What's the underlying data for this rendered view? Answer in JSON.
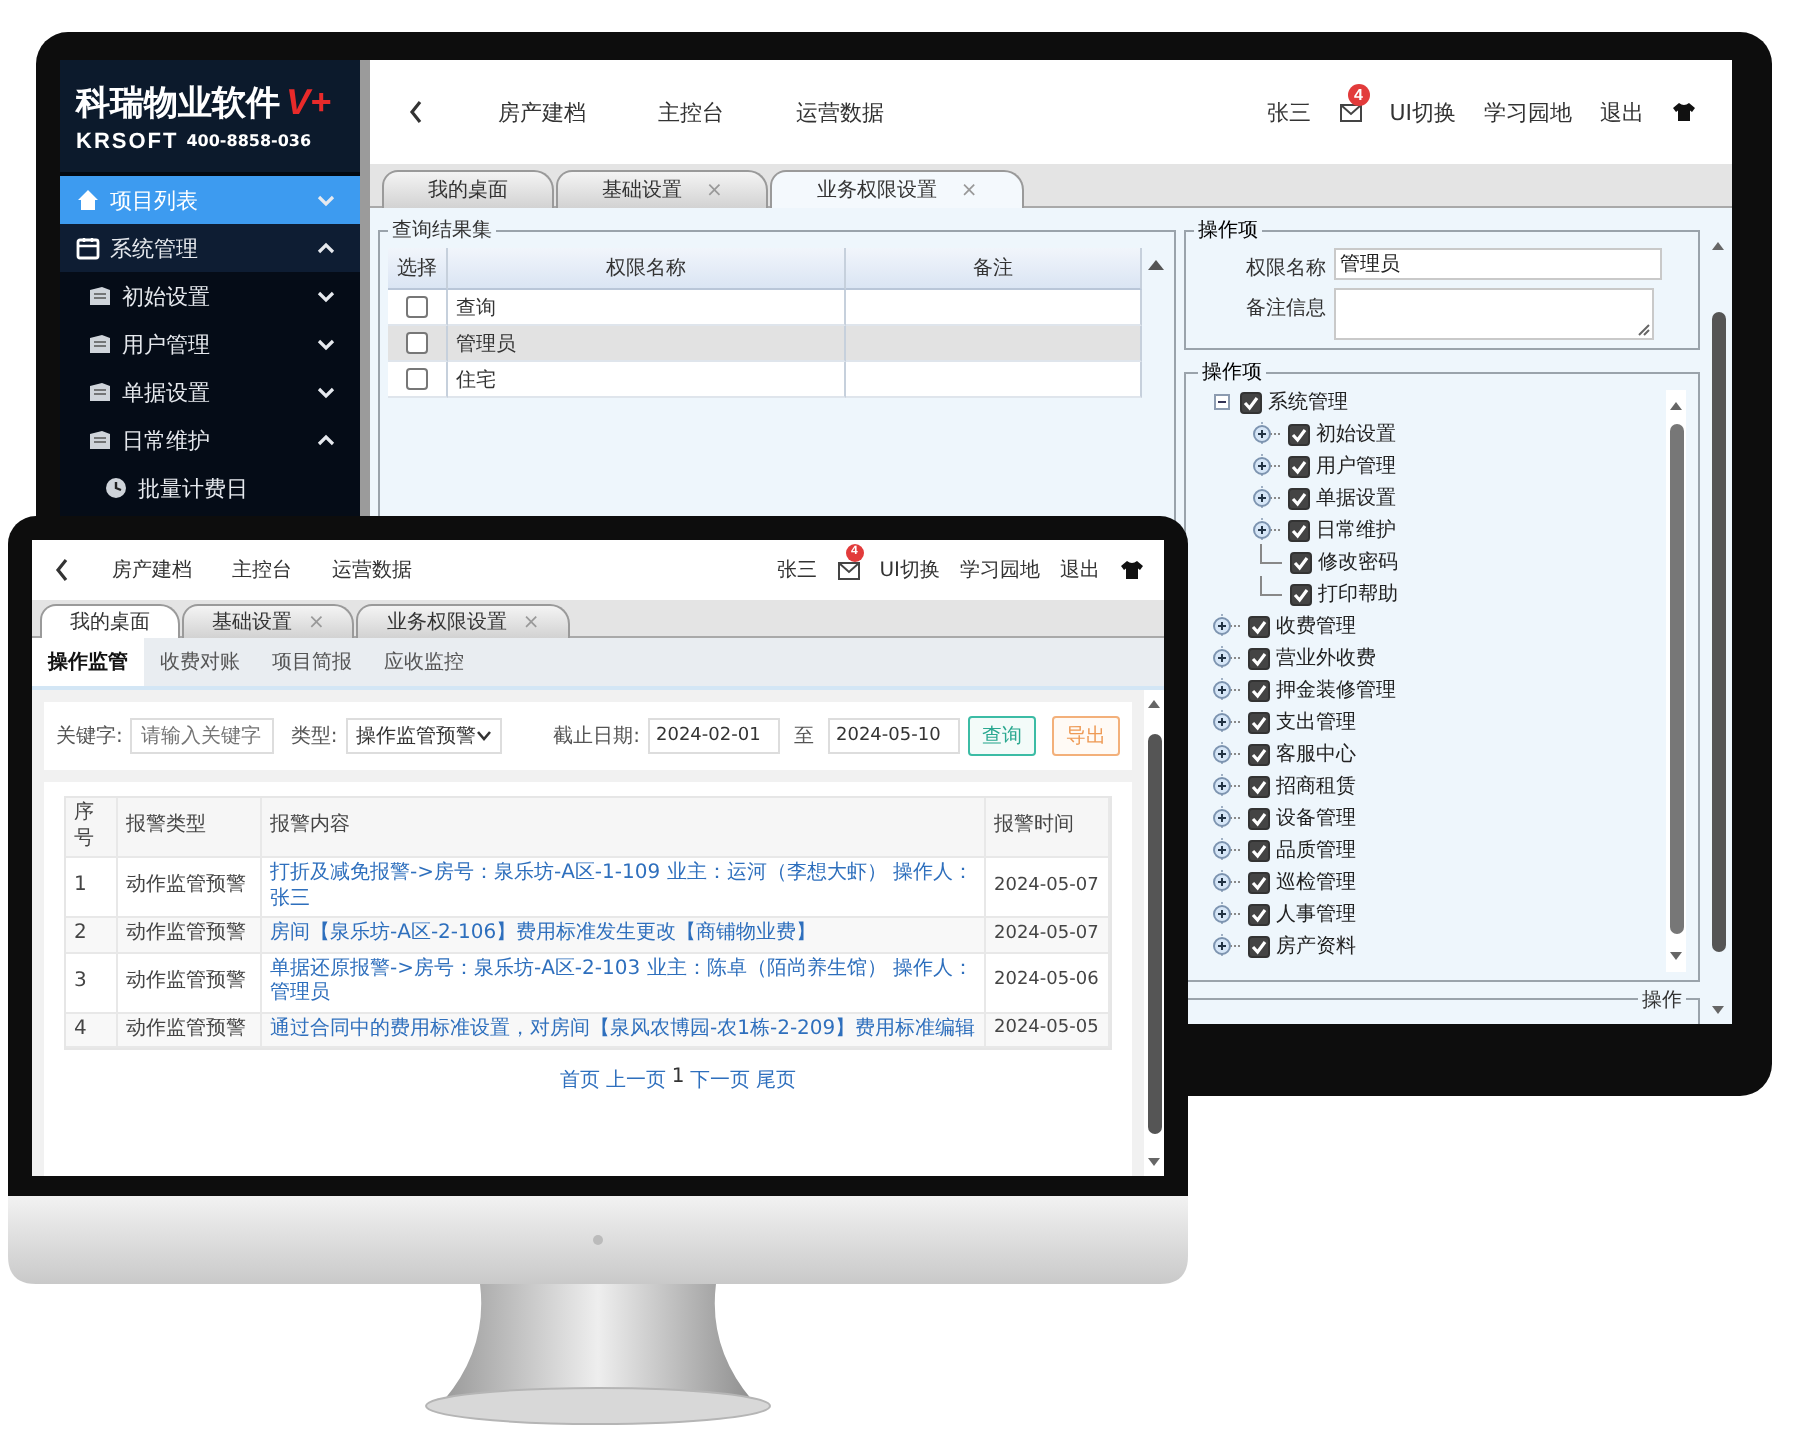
{
  "back_screen": {
    "logo": {
      "title": "科瑞物业软件",
      "badge": "V+",
      "brand": "KRSOFT",
      "phone": "400-8858-036"
    },
    "sidebar": {
      "items": [
        {
          "label": "项目列表",
          "selected": true,
          "expanded": false
        },
        {
          "label": "系统管理",
          "selected": false,
          "expanded": true,
          "children": [
            {
              "label": "初始设置",
              "selected": false,
              "expanded": false
            },
            {
              "label": "用户管理",
              "selected": false,
              "expanded": false
            },
            {
              "label": "单据设置",
              "selected": false,
              "expanded": false
            },
            {
              "label": "日常维护",
              "selected": false,
              "expanded": true,
              "children": [
                {
                  "label": "批量计费日",
                  "selected": false
                }
              ]
            }
          ]
        }
      ]
    },
    "header": {
      "nav": [
        "房产建档",
        "主控台",
        "运营数据"
      ],
      "user": "张三",
      "mail_count": "4",
      "links": [
        "UI切换",
        "学习园地",
        "退出"
      ]
    },
    "tabs": [
      {
        "label": "我的桌面",
        "selected": false
      },
      {
        "label": "基础设置",
        "close": "×",
        "selected": false
      },
      {
        "label": "业务权限设置",
        "close": "×",
        "selected": true
      }
    ],
    "results": {
      "title": "查询结果集",
      "columns": [
        "选择",
        "权限名称",
        "备注"
      ],
      "rows": [
        {
          "name": "查询",
          "checked": false,
          "selected": false
        },
        {
          "name": "管理员",
          "checked": false,
          "selected": true
        },
        {
          "name": "住宅",
          "checked": false,
          "selected": false
        }
      ]
    },
    "form": {
      "title": "操作项",
      "fields": [
        {
          "label": "权限名称",
          "value": "管理员",
          "kind": "input"
        },
        {
          "label": "备注信息",
          "kind": "textarea"
        }
      ]
    },
    "tree": {
      "title": "操作项",
      "nodes": [
        {
          "label": "系统管理",
          "checked": true,
          "expanded": true,
          "children": [
            {
              "label": "初始设置",
              "checked": true,
              "expanded": false
            },
            {
              "label": "用户管理",
              "checked": true,
              "expanded": false
            },
            {
              "label": "单据设置",
              "checked": true,
              "expanded": false
            },
            {
              "label": "日常维护",
              "checked": true,
              "expanded": false
            },
            {
              "label": "修改密码",
              "checked": true
            },
            {
              "label": "打印帮助",
              "checked": true
            }
          ]
        },
        {
          "label": "收费管理",
          "checked": true,
          "expanded": false
        },
        {
          "label": "营业外收费",
          "checked": true,
          "expanded": false
        },
        {
          "label": "押金装修管理",
          "checked": true,
          "expanded": false
        },
        {
          "label": "支出管理",
          "checked": true,
          "expanded": false
        },
        {
          "label": "客服中心",
          "checked": true,
          "expanded": false
        },
        {
          "label": "招商租赁",
          "checked": true,
          "expanded": false
        },
        {
          "label": "设备管理",
          "checked": true,
          "expanded": false
        },
        {
          "label": "品质管理",
          "checked": true,
          "expanded": false
        },
        {
          "label": "巡检管理",
          "checked": true,
          "expanded": false
        },
        {
          "label": "人事管理",
          "checked": true,
          "expanded": false
        },
        {
          "label": "房产资料",
          "checked": true,
          "expanded": false
        }
      ]
    },
    "actions": {
      "title": "操作"
    }
  },
  "front_screen": {
    "header": {
      "nav": [
        "房产建档",
        "主控台",
        "运营数据"
      ],
      "user": "张三",
      "mail_count": "4",
      "links": [
        "UI切换",
        "学习园地",
        "退出"
      ]
    },
    "tabs": [
      {
        "label": "我的桌面",
        "selected": true
      },
      {
        "label": "基础设置",
        "close": "×",
        "selected": false
      },
      {
        "label": "业务权限设置",
        "close": "×",
        "selected": false
      }
    ],
    "subtabs": [
      {
        "label": "操作监管",
        "selected": true
      },
      {
        "label": "收费对账",
        "selected": false
      },
      {
        "label": "项目简报",
        "selected": false
      },
      {
        "label": "应收监控",
        "selected": false
      }
    ],
    "filter": {
      "keyword": {
        "label": "关键字:",
        "placeholder": "请输入关键字"
      },
      "type": {
        "label": "类型:",
        "value": "操作监管预警"
      },
      "date": {
        "label": "截止日期:",
        "from": "2024-02-01",
        "separator": "至",
        "to": "2024-05-10"
      },
      "buttons": [
        {
          "label": "查询",
          "kind": "query"
        },
        {
          "label": "导出",
          "kind": "export"
        }
      ]
    },
    "table": {
      "columns": [
        "序号",
        "报警类型",
        "报警内容",
        "报警时间"
      ],
      "rows": [
        {
          "no": "1",
          "type": "动作监管预警",
          "content": "打折及减免报警->房号：泉乐坊-A区-1-109 业主：运河（李想大虾） 操作人：张三",
          "time": "2024-05-07"
        },
        {
          "no": "2",
          "type": "动作监管预警",
          "content": "房间【泉乐坊-A区-2-106】费用标准发生更改【商铺物业费】",
          "time": "2024-05-07"
        },
        {
          "no": "3",
          "type": "动作监管预警",
          "content": "单据还原报警->房号：泉乐坊-A区-2-103 业主：陈卓（陌尚养生馆） 操作人：管理员",
          "time": "2024-05-06"
        },
        {
          "no": "4",
          "type": "动作监管预警",
          "content": "通过合同中的费用标准设置，对房间【泉风农博园-农1栋-2-209】费用标准编辑",
          "time": "2024-05-05"
        }
      ]
    },
    "pagination": [
      {
        "label": "首页",
        "kind": "link"
      },
      {
        "label": "上一页",
        "kind": "link"
      },
      {
        "label": "1",
        "kind": "current"
      },
      {
        "label": "下一页",
        "kind": "link"
      },
      {
        "label": "尾页",
        "kind": "link"
      }
    ]
  }
}
